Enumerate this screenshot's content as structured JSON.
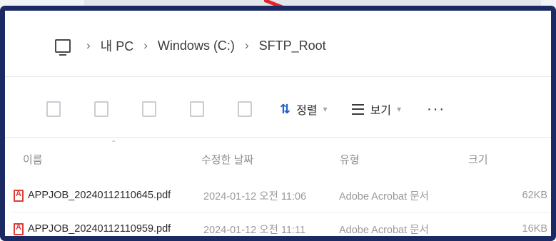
{
  "address_bar": {
    "crumbs": [
      "내 PC",
      "Windows (C:)",
      "SFTP_Root"
    ]
  },
  "toolbar": {
    "sort_label": "정렬",
    "view_label": "보기",
    "more_label": "···"
  },
  "file_list": {
    "headers": [
      "이름",
      "수정한 날짜",
      "유형",
      "크기"
    ],
    "rows": [
      {
        "name": "APPJOB_20240112110645.pdf",
        "date": "2024-01-12 오전 11:06",
        "type": "Adobe Acrobat 문서",
        "size": "62KB"
      },
      {
        "name": "APPJOB_20240112110959.pdf",
        "date": "2024-01-12 오전 11:11",
        "type": "Adobe Acrobat 문서",
        "size": "16KB"
      }
    ]
  },
  "colors": {
    "frame": "#1b2a63",
    "accent": "#1d5fd0",
    "pdf_red": "#e03b36",
    "annotation_arrow": "#e0282a"
  },
  "icons": [
    "pc-icon",
    "sort-icon",
    "view-lines-icon",
    "more-icon",
    "pdf-icon"
  ]
}
